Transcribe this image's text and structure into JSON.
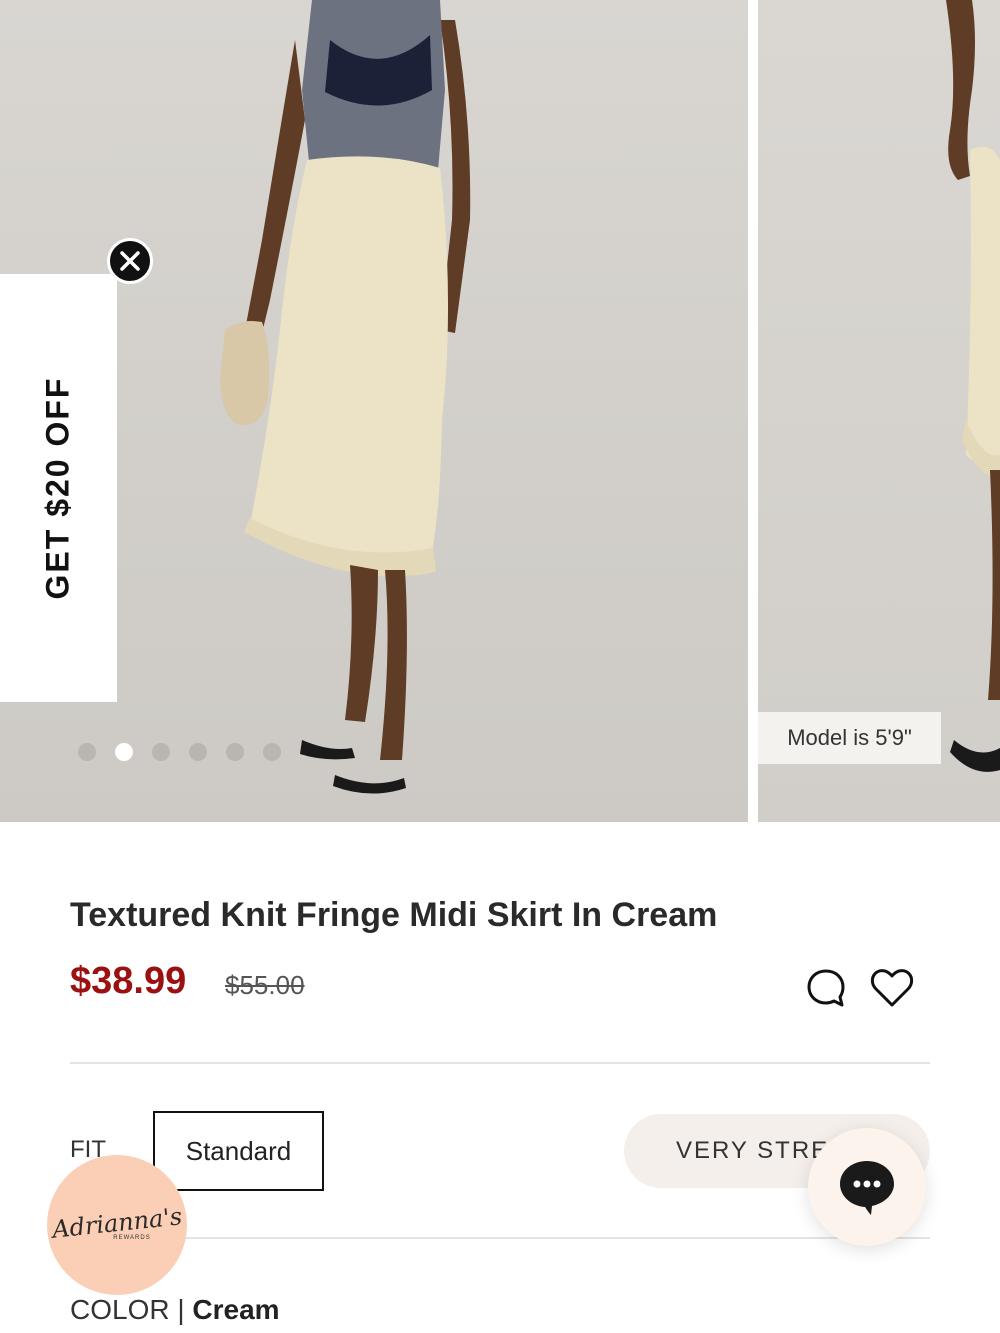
{
  "gallery": {
    "slide_count": 6,
    "active_slide": 2,
    "model_note": "Model is 5'9\""
  },
  "promo": {
    "label": "GET $20 OFF"
  },
  "product": {
    "title": "Textured Knit Fringe Midi Skirt In Cream",
    "sale_price": "$38.99",
    "original_price": "$55.00",
    "sale_color": "#9b1010"
  },
  "fit": {
    "label": "FIT",
    "selected_option": "Standard",
    "stretch_label": "VERY STRET"
  },
  "color": {
    "label": "COLOR",
    "separator": " | ",
    "value": "Cream"
  },
  "rewards": {
    "script_text": "Adrianna's",
    "sub_text": "REWARDS"
  },
  "icons": [
    "close-icon",
    "chat-bubble-icon",
    "heart-icon",
    "chat-ellipsis-icon"
  ]
}
